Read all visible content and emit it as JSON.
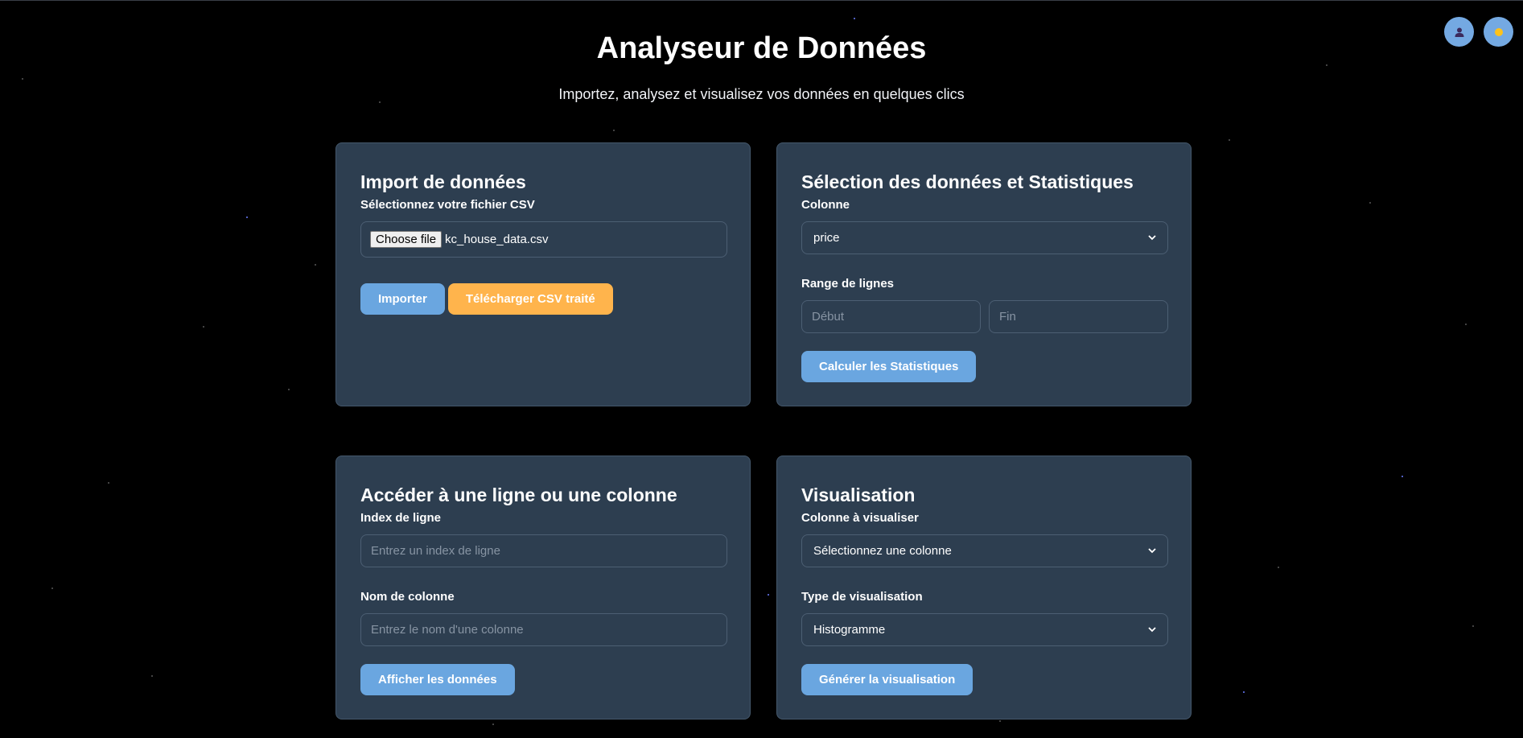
{
  "header": {
    "title": "Analyseur de Données",
    "subtitle": "Importez, analysez et visualisez vos données en quelques clics"
  },
  "top_controls": {
    "user_icon": "user-icon",
    "theme_icon": "sun-icon"
  },
  "import_card": {
    "title": "Import de données",
    "file_label": "Sélectionnez votre fichier CSV",
    "file_button": "Choose file",
    "file_name": "kc_house_data.csv",
    "import_button": "Importer",
    "download_button": "Télécharger CSV traité"
  },
  "stats_card": {
    "title": "Sélection des données et Statistiques",
    "column_label": "Colonne",
    "column_value": "price",
    "range_label": "Range de lignes",
    "start_placeholder": "Début",
    "end_placeholder": "Fin",
    "compute_button": "Calculer les Statistiques"
  },
  "access_card": {
    "title": "Accéder à une ligne ou une colonne",
    "row_label": "Index de ligne",
    "row_placeholder": "Entrez un index de ligne",
    "column_label": "Nom de colonne",
    "column_placeholder": "Entrez le nom d'une colonne",
    "show_button": "Afficher les données"
  },
  "viz_card": {
    "title": "Visualisation",
    "column_label": "Colonne à visualiser",
    "column_value": "Sélectionnez une colonne",
    "type_label": "Type de visualisation",
    "type_value": "Histogramme",
    "generate_button": "Générer la visualisation"
  },
  "colors": {
    "background": "#000000",
    "card": "#2d3e50",
    "accent_blue": "#6aa6e0",
    "accent_orange": "#ffb44c"
  }
}
